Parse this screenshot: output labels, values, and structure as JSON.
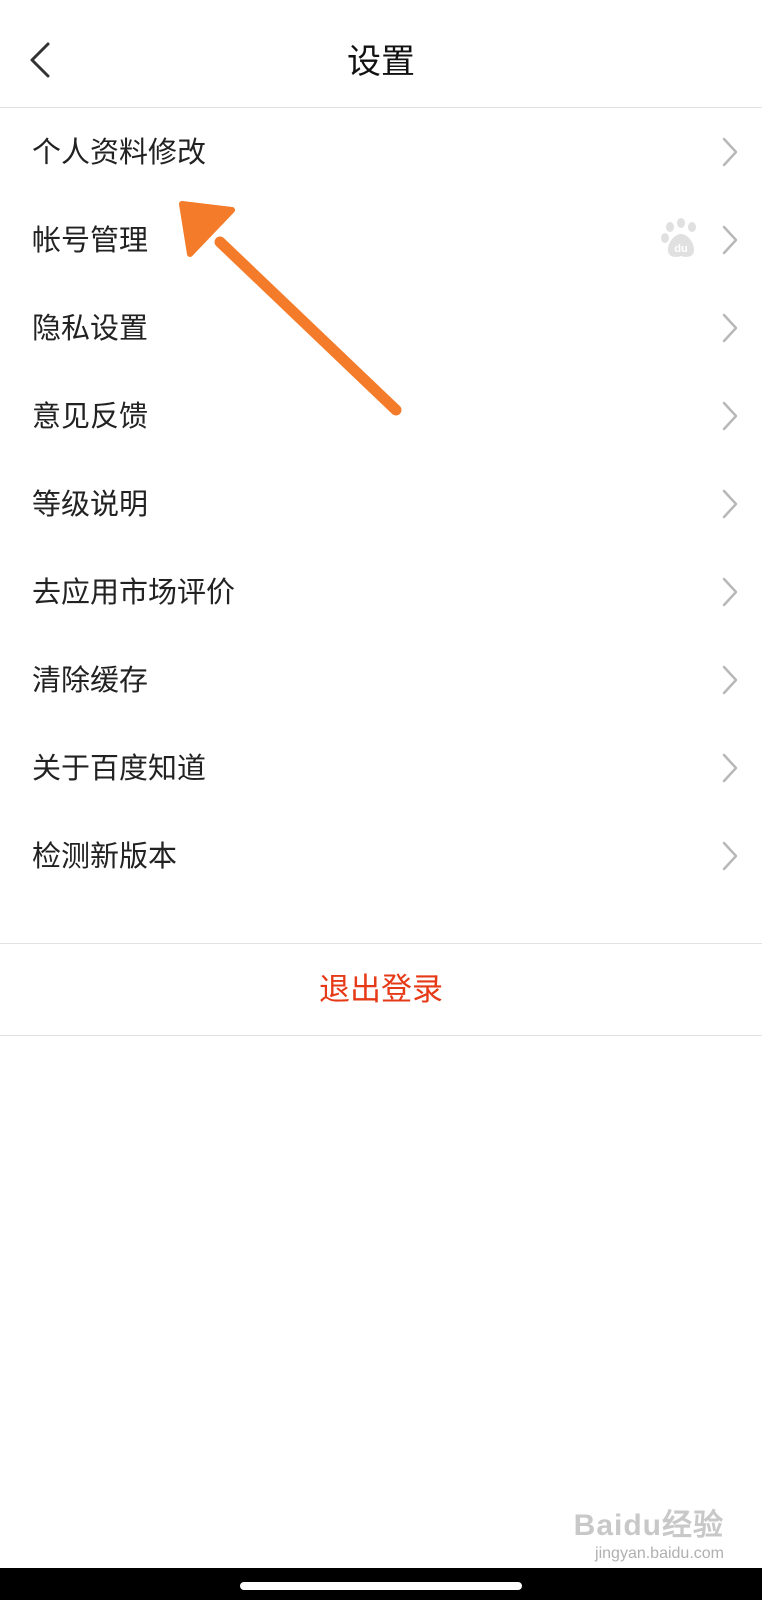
{
  "header": {
    "title": "设置",
    "back_icon": "chevron-left-icon"
  },
  "menu": {
    "items": [
      {
        "label": "个人资料修改"
      },
      {
        "label": "帐号管理",
        "badge_icon": "baidu-paw-icon"
      },
      {
        "label": "隐私设置"
      },
      {
        "label": "意见反馈"
      },
      {
        "label": "等级说明"
      },
      {
        "label": "去应用市场评价"
      },
      {
        "label": "清除缓存"
      },
      {
        "label": "关于百度知道"
      },
      {
        "label": "检测新版本"
      }
    ],
    "chevron_icon": "chevron-right-icon"
  },
  "logout": {
    "label": "退出登录",
    "color": "#e63a17"
  },
  "annotation": {
    "arrow_color": "#f47b2a"
  },
  "watermark": {
    "brand": "Baidu经验",
    "url": "jingyan.baidu.com"
  }
}
